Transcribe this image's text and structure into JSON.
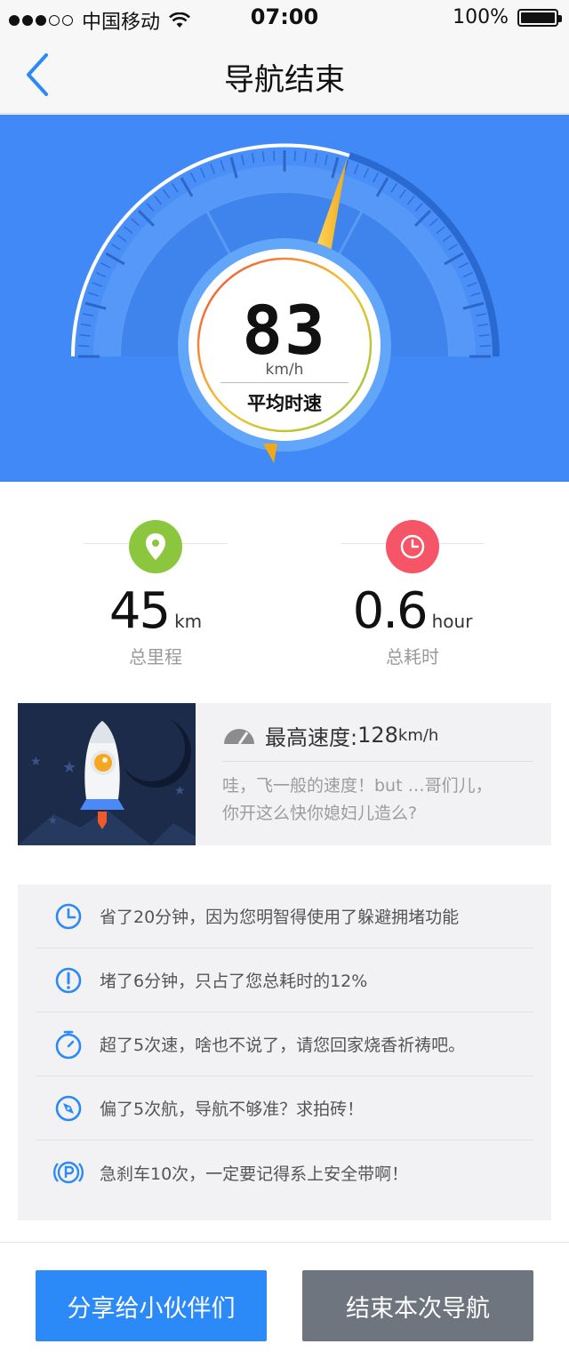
{
  "status_bar": {
    "carrier": "中国移动",
    "time": "07:00",
    "battery": "100%",
    "signal_dots_filled": 3,
    "signal_dots_total": 5
  },
  "nav": {
    "title": "导航结束"
  },
  "gauge": {
    "speed": "83",
    "unit": "km/h",
    "label": "平均时速",
    "speed_value": 83
  },
  "stats": [
    {
      "value": "45",
      "unit": "km",
      "label": "总里程",
      "icon": "location-pin-icon",
      "color": "#8cc63f"
    },
    {
      "value": "0.6",
      "unit": "hour",
      "label": "总耗时",
      "icon": "clock-icon",
      "color": "#f55566"
    }
  ],
  "max_speed": {
    "title": "最高速度:",
    "value": "128",
    "unit": "km/h",
    "desc_line1": "哇，飞一般的速度！but …哥们儿，",
    "desc_line2": "你开这么快你媳妇儿造么?"
  },
  "tips": [
    {
      "icon": "clock-icon",
      "text": "省了20分钟，因为您明智得使用了躲避拥堵功能"
    },
    {
      "icon": "alert-icon",
      "text": "堵了6分钟，只占了您总耗时的12%"
    },
    {
      "icon": "stopwatch-icon",
      "text": "超了5次速，啥也不说了，请您回家烧香祈祷吧。"
    },
    {
      "icon": "compass-icon",
      "text": "偏了5次航，导航不够准？求拍砖！"
    },
    {
      "icon": "parking-brake-icon",
      "text": "急刹车10次，一定要记得系上安全带啊！"
    }
  ],
  "buttons": {
    "share": "分享给小伙伴们",
    "end": "结束本次导航"
  },
  "colors": {
    "primary_blue": "#4089f6",
    "icon_blue": "#2b8af7",
    "green": "#8cc63f",
    "red": "#f55566",
    "end_button_gray": "#6f757e"
  }
}
